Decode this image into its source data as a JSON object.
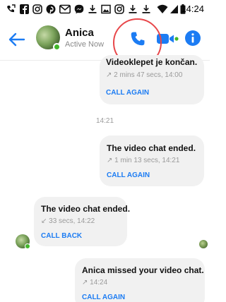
{
  "status_bar": {
    "time": "14:24",
    "icons": [
      "missed-call-icon",
      "facebook-icon",
      "instagram-icon",
      "pinterest-icon",
      "gmail-icon",
      "messenger-icon",
      "download-icon",
      "gallery-icon",
      "instagram-icon",
      "download-icon",
      "download-icon",
      "wifi-icon",
      "signal-icon",
      "battery-icon"
    ]
  },
  "header": {
    "name": "Anica",
    "status": "Active Now",
    "accent_color": "#1c7cf3"
  },
  "messages": [
    {
      "title": "Videoklepet je končan.",
      "meta": "↗ 2 mins 47 secs, 14:00",
      "action": "CALL AGAIN"
    },
    {
      "title": "The video chat ended.",
      "meta": "↗ 1 min 13 secs, 14:21",
      "action": "CALL AGAIN"
    },
    {
      "title": "The video chat ended.",
      "meta": "↙ 33 secs, 14:22",
      "action": "CALL BACK"
    },
    {
      "title": "Anica missed your video chat.",
      "meta": "↗ 14:24",
      "action": "CALL AGAIN"
    }
  ],
  "timestamp": "14:21"
}
